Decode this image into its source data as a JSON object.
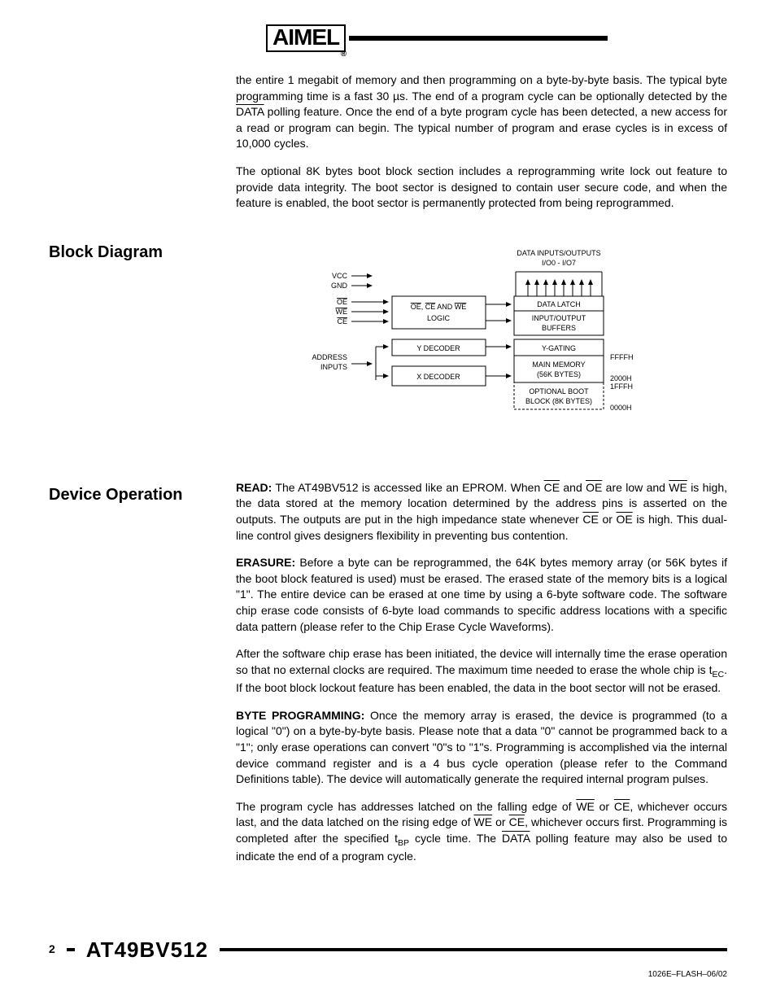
{
  "logo_text": "AIMEL",
  "paragraphs": {
    "intro1_a": "the entire 1 megabit of memory and then programming on a byte-by-byte basis. The typical byte programming time is a fast 30 µs. The end of a program cycle can be optionally detected by the ",
    "intro1_data": "DATA",
    "intro1_b": " polling feature. Once the end of a byte program cycle has been detected, a new access for a read or program can begin. The typical number of program and erase cycles is in excess of 10,000 cycles.",
    "intro2": "The optional 8K bytes boot block section includes a reprogramming write lock out feature to provide data integrity. The boot sector is designed to contain user secure code, and when the feature is enabled, the boot sector is permanently protected from being reprogrammed."
  },
  "headings": {
    "block_diagram": "Block Diagram",
    "device_operation": "Device Operation"
  },
  "diagram": {
    "top_label": "DATA INPUTS/OUTPUTS",
    "io_label": "I/O0 - I/O7",
    "vcc": "VCC",
    "gnd": "GND",
    "oe": "OE",
    "we": "WE",
    "ce": "CE",
    "logic_a": "OE, CE AND WE",
    "logic_b": "LOGIC",
    "data_latch": "DATA LATCH",
    "io_buffers_a": "INPUT/OUTPUT",
    "io_buffers_b": "BUFFERS",
    "y_decoder": "Y DECODER",
    "y_gating": "Y-GATING",
    "x_decoder": "X DECODER",
    "main_mem_a": "MAIN MEMORY",
    "main_mem_b": "(56K BYTES)",
    "addr_a": "ADDRESS",
    "addr_b": "INPUTS",
    "boot_a": "OPTIONAL BOOT",
    "boot_b": "BLOCK (8K BYTES)",
    "ffffh": "FFFFH",
    "2000h": "2000H",
    "1fffh": "1FFFH",
    "0000h": "0000H"
  },
  "device": {
    "read_label": "READ:",
    "read_a": " The AT49BV512 is accessed like an EPROM. When ",
    "read_ce": "CE",
    "read_b": " and ",
    "read_oe": "OE",
    "read_c": " are low and ",
    "read_we": "WE",
    "read_d": " is high, the data stored at the memory location determined by the address pins is asserted on the outputs. The outputs are put in the high impedance state whenever ",
    "read_ce2": "CE",
    "read_e": " or ",
    "read_oe2": "OE",
    "read_f": " is high. This dual-line control gives designers flexibility in preventing bus contention.",
    "erasure_label": "ERASURE:",
    "erasure_text": " Before a byte can be reprogrammed, the 64K bytes memory array (or 56K bytes if the boot block featured is used) must be erased. The erased state of the memory bits is a logical \"1\". The entire device can be erased at one time by using a 6-byte software code. The software chip erase code consists of 6-byte load commands to specific address locations with a specific data pattern (please refer to the Chip Erase Cycle Waveforms).",
    "erase2_a": "After the software chip erase has been initiated, the device will internally time the erase operation so that no external clocks are required. The maximum time needed to erase the whole chip is t",
    "erase2_sub": "EC",
    "erase2_b": ". If the boot block lockout feature has been enabled, the data in the boot sector will not be erased.",
    "byte_label": "BYTE PROGRAMMING:",
    "byte_text": " Once the memory array is erased, the device is programmed (to a logical \"0\") on a byte-by-byte basis. Please note that a data \"0\" cannot be programmed back to a \"1\"; only erase operations can convert \"0\"s to \"1\"s. Programming is accomplished via the internal device command register and is a 4 bus cycle operation (please refer to the Command Definitions table). The device will automatically generate the required internal program pulses.",
    "prog2_a": "The program cycle has addresses latched on the falling edge of ",
    "prog2_we": "WE",
    "prog2_b": " or ",
    "prog2_ce": "CE",
    "prog2_c": ", whichever occurs last, and the data latched on the rising edge of ",
    "prog2_we2": "WE",
    "prog2_d": " or ",
    "prog2_ce2": "CE",
    "prog2_e": ", whichever occurs first. Programming is completed after the specified t",
    "prog2_sub": "BP",
    "prog2_f": " cycle time. The ",
    "prog2_data": "DATA",
    "prog2_g": " polling feature may also be used to indicate the end of a program cycle."
  },
  "footer": {
    "page": "2",
    "product": "AT49BV512",
    "rev": "1026E–FLASH–06/02"
  }
}
